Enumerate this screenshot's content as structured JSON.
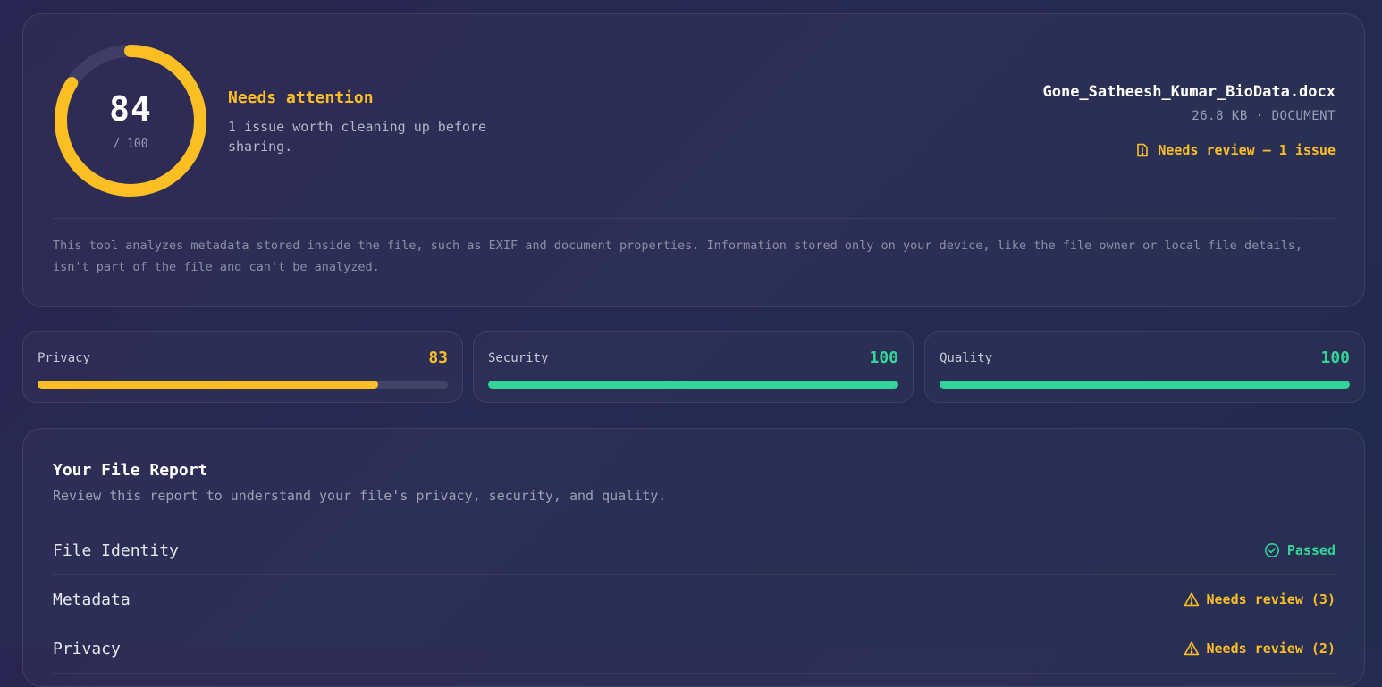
{
  "summary": {
    "score": "84",
    "score_max": "/ 100",
    "score_fraction": 0.84,
    "status_title": "Needs attention",
    "status_desc": "1 issue worth cleaning up before sharing.",
    "file_name": "Gone_Satheesh_Kumar_BioData.docx",
    "file_meta": "26.8 KB · DOCUMENT",
    "review_label": "Needs review — 1 issue",
    "disclaimer": "This tool analyzes metadata stored inside the file, such as EXIF and document properties. Information stored only on your device, like the file owner or local file details, isn't part of the file and can't be analyzed."
  },
  "colors": {
    "warning": "#fbbf24",
    "success": "#34d399",
    "track": "#3f3c66"
  },
  "scores": [
    {
      "label": "Privacy",
      "value": "83",
      "percent": 83,
      "color": "#fbbf24"
    },
    {
      "label": "Security",
      "value": "100",
      "percent": 100,
      "color": "#34d399"
    },
    {
      "label": "Quality",
      "value": "100",
      "percent": 100,
      "color": "#34d399"
    }
  ],
  "report": {
    "title": "Your File Report",
    "subtitle": "Review this report to understand your file's privacy, security, and quality.",
    "rows": [
      {
        "name": "File Identity",
        "status": "Passed",
        "icon": "check-circle-icon",
        "color": "#34d399"
      },
      {
        "name": "Metadata",
        "status": "Needs review (3)",
        "icon": "warning-triangle-icon",
        "color": "#fbbf24"
      },
      {
        "name": "Privacy",
        "status": "Needs review (2)",
        "icon": "warning-triangle-icon",
        "color": "#fbbf24"
      }
    ]
  }
}
